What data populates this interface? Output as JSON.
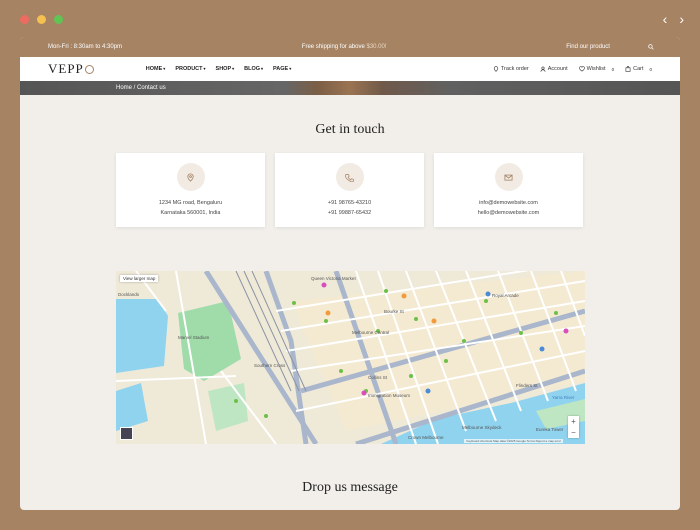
{
  "window": {
    "colors": {
      "close": "#ee6b61",
      "minimize": "#f5c04f",
      "maximize": "#5fc454"
    },
    "nav": {
      "back_icon": "chevron-left-icon",
      "forward_icon": "chevron-right-icon"
    }
  },
  "topbar": {
    "hours": "Mon-Fri : 8:30am to 4:30pm",
    "shipping_prefix": "Free shipping for above ",
    "shipping_amount": "$30.00!",
    "find": "Find our product",
    "search_icon": "search-icon"
  },
  "header": {
    "logo": "VEPP",
    "menu": [
      {
        "label": "HOME"
      },
      {
        "label": "PRODUCT"
      },
      {
        "label": "SHOP"
      },
      {
        "label": "BLOG"
      },
      {
        "label": "PAGE"
      }
    ],
    "actions": {
      "track": "Track order",
      "account": "Account",
      "wishlist": "Wishlist",
      "wishlist_count": "0",
      "cart": "Cart",
      "cart_count": "0"
    }
  },
  "breadcrumb": "Home / Contact us",
  "contact": {
    "title": "Get in touch",
    "cards": [
      {
        "icon": "location-pin-icon",
        "line1": "1234 MG road, Bengaluru",
        "line2": "Karnataka 560001, India"
      },
      {
        "icon": "phone-icon",
        "line1": "+91 98765-43210",
        "line2": "+91 99887-65432"
      },
      {
        "icon": "mail-icon",
        "line1": "info@demowebsite.com",
        "line2": "hello@demowebsite.com"
      }
    ]
  },
  "map": {
    "view_larger": "View larger map",
    "zoom_in": "+",
    "zoom_out": "−",
    "attribution": "Keyboard shortcuts   Map data ©2025 Google   Terms   Report a map error",
    "labels": [
      "Docklands",
      "Marvel Stadium",
      "Southern Cross",
      "Bourke St",
      "Collins St",
      "Flinders St",
      "Queen Victoria Market",
      "Melbourne Central",
      "Royal Arcade",
      "Melbourne Skydeck",
      "Immigration Museum",
      "Yarra River",
      "Crown Melbourne",
      "Eureka Tower"
    ]
  },
  "drop": {
    "title": "Drop us message"
  }
}
